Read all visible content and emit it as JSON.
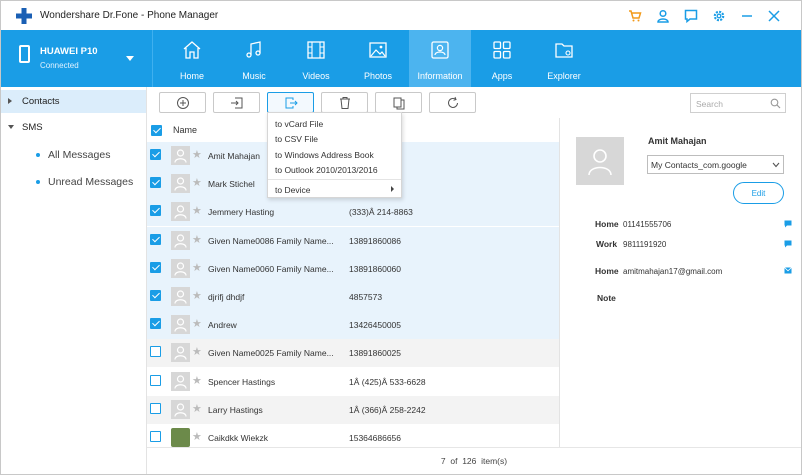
{
  "window": {
    "title": "Wondershare Dr.Fone - Phone Manager",
    "brand_color": "#1a9de6",
    "title_icons": [
      "cart-icon",
      "user-icon",
      "chat-icon",
      "settings-icon",
      "minimize-icon",
      "close-icon"
    ]
  },
  "device": {
    "name": "HUAWEI P10",
    "status": "Connected"
  },
  "nav": {
    "tabs": [
      {
        "label": "Home",
        "icon": "home-icon"
      },
      {
        "label": "Music",
        "icon": "music-icon"
      },
      {
        "label": "Videos",
        "icon": "video-icon"
      },
      {
        "label": "Photos",
        "icon": "photo-icon"
      },
      {
        "label": "Information",
        "icon": "contacts-icon",
        "active": true
      },
      {
        "label": "Apps",
        "icon": "apps-icon"
      },
      {
        "label": "Explorer",
        "icon": "folder-icon"
      }
    ]
  },
  "sidebar": {
    "contacts": "Contacts",
    "sms": "SMS",
    "sms_items": [
      "All Messages",
      "Unread Messages"
    ]
  },
  "toolbar": {
    "buttons": [
      "add-icon",
      "import-icon",
      "export-icon",
      "delete-icon",
      "merge-icon",
      "refresh-icon"
    ],
    "search_placeholder": "Search"
  },
  "table": {
    "header_name": "Name",
    "rows": [
      {
        "name": "Amit Mahajan",
        "phone": "",
        "checked": true
      },
      {
        "name": "Mark Stichel",
        "phone": "",
        "checked": true
      },
      {
        "name": "Jemmery  Hasting",
        "phone": "(333)Â 214-8863",
        "checked": true
      },
      {
        "name": "Given Name0086  Family Name...",
        "phone": "13891860086",
        "checked": true
      },
      {
        "name": "Given Name0060  Family Name...",
        "phone": "13891860060",
        "checked": true
      },
      {
        "name": "djrifj  dhdjf",
        "phone": "4857573",
        "checked": true
      },
      {
        "name": "Andrew",
        "phone": "13426450005",
        "checked": true
      },
      {
        "name": "Given Name0025  Family Name...",
        "phone": "13891860025",
        "checked": false
      },
      {
        "name": "Spencer  Hastings",
        "phone": "1Â (425)Â 533-6628",
        "checked": false
      },
      {
        "name": "Larry  Hastings",
        "phone": "1Â (366)Â 258-2242",
        "checked": false
      },
      {
        "name": "Caikdkk  Wiekzk",
        "phone": "15364686656",
        "checked": false
      }
    ]
  },
  "export_menu": {
    "items": [
      "to vCard File",
      "to CSV File",
      "to Windows Address Book",
      "to Outlook 2010/2013/2016",
      "to Device"
    ]
  },
  "status": {
    "selected": "7",
    "of": "of",
    "total": "126",
    "unit": "item(s)"
  },
  "details": {
    "name": "Amit Mahajan",
    "account": "My Contacts_com.google",
    "edit_label": "Edit",
    "fields": [
      {
        "label": "Home",
        "value": "01141555706",
        "icon": "message-icon"
      },
      {
        "label": "Work",
        "value": "9811191920",
        "icon": "message-icon"
      },
      {
        "label": "Home",
        "value": "amitmahajan17@gmail.com",
        "icon": "email-icon"
      },
      {
        "label": "Note",
        "value": ""
      }
    ]
  }
}
